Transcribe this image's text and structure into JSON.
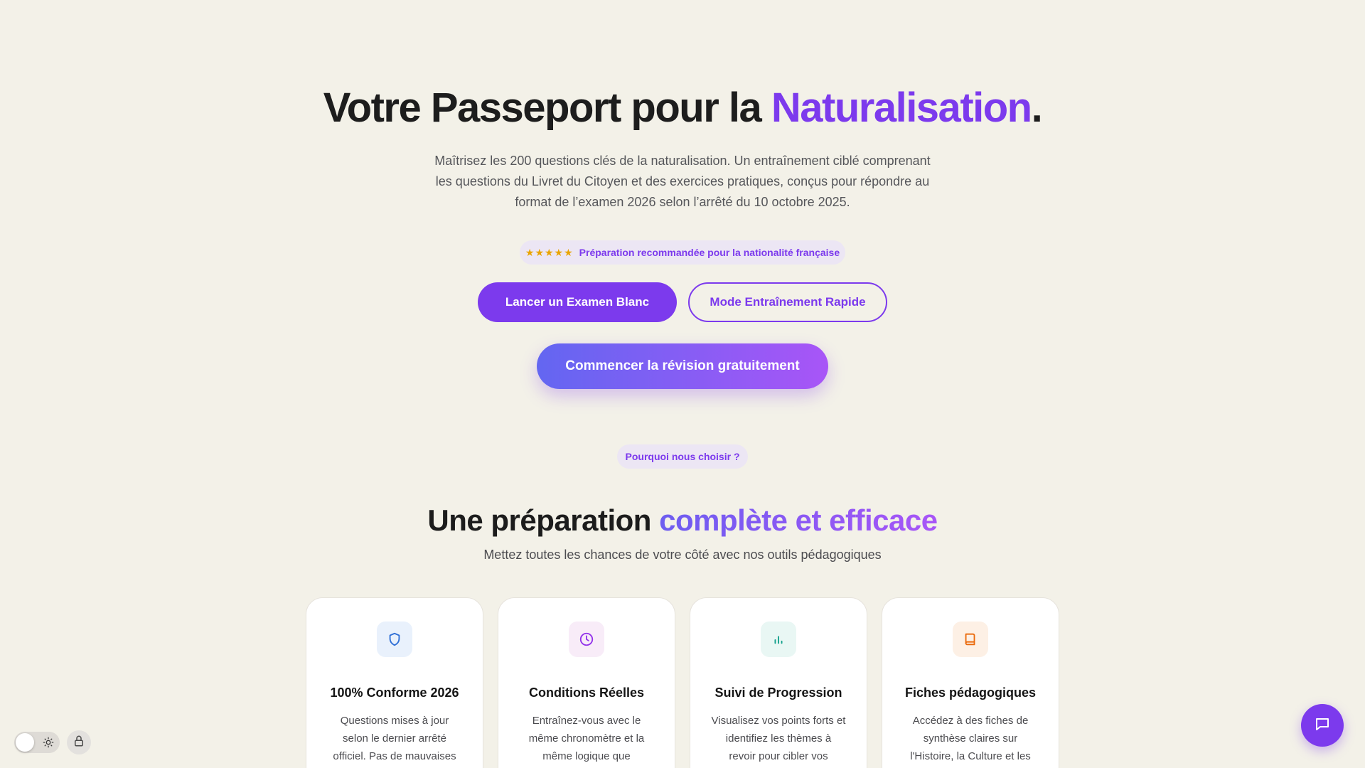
{
  "hero": {
    "title_main": "Votre Passeport pour la ",
    "title_accent": "Naturalisation",
    "title_end": ".",
    "subtitle": "Maîtrisez les 200 questions clés de la naturalisation. Un entraînement ciblé comprenant les questions du Livret du Citoyen et des exercices pratiques, conçus pour répondre au format de l’examen 2026 selon l’arrêté du 10 octobre 2025.",
    "badge_stars": "★★★★★",
    "badge_text": "Préparation recommandée pour la nationalité française",
    "primary_button": "Lancer un Examen Blanc",
    "outline_button": "Mode Entraînement Rapide",
    "cta_button": "Commencer la révision gratuitement"
  },
  "features": {
    "eyebrow": "Pourquoi nous choisir ?",
    "title_main": "Une préparation ",
    "title_accent": "complète et efficace",
    "subtitle": "Mettez toutes les chances de votre côté avec nos outils pédagogiques",
    "cards": [
      {
        "icon": "shield-icon",
        "color": "#2f6fd6",
        "title": "100% Conforme 2026",
        "desc": "Questions mises à jour selon le dernier arrêté officiel. Pas de mauvaises"
      },
      {
        "icon": "clock-icon",
        "color": "#9333ea",
        "title": "Conditions Réelles",
        "desc": "Entraînez-vous avec le même chronomètre et la même logique que"
      },
      {
        "icon": "bar-chart-icon",
        "color": "#0f9f8a",
        "title": "Suivi de Progression",
        "desc": "Visualisez vos points forts et identifiez les thèmes à revoir pour cibler vos"
      },
      {
        "icon": "book-icon",
        "color": "#ea6a0c",
        "title": "Fiches pédagogiques",
        "desc": "Accédez à des fiches de synthèse claires sur l'Histoire, la Culture et les"
      }
    ]
  },
  "colors": {
    "accent": "#7c3aed",
    "background": "#f3f1e8"
  }
}
